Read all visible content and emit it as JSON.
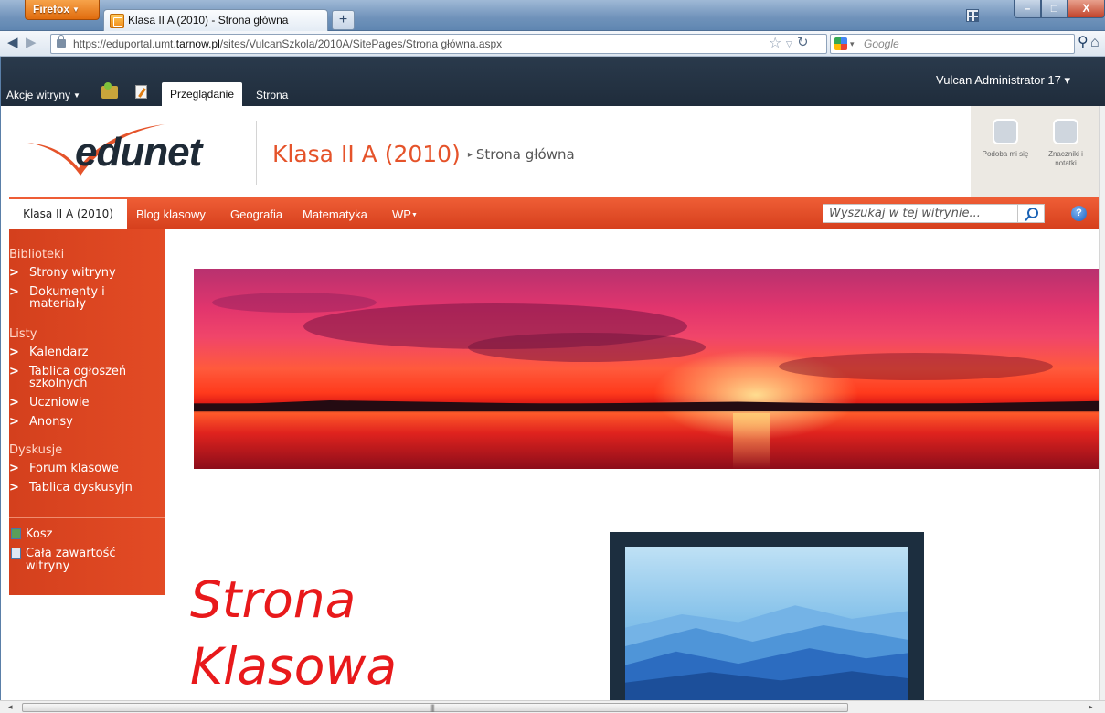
{
  "browser": {
    "app_button": "Firefox",
    "tab_title": "Klasa II A (2010) - Strona główna",
    "new_tab": "+",
    "url_prefix": "https://eduportal.umt.",
    "url_host": "tarnow.pl",
    "url_path": "/sites/VulcanSzkola/2010A/SitePages/Strona główna.aspx",
    "search_engine_placeholder": "Google",
    "window_buttons": {
      "minimize": "–",
      "maximize": "□",
      "close": "X"
    }
  },
  "ribbon": {
    "site_actions": "Akcje witryny",
    "tabs": [
      {
        "label": "Przeglądanie",
        "active": true
      },
      {
        "label": "Strona",
        "active": false
      }
    ],
    "user": "Vulcan Administrator 17"
  },
  "header": {
    "logo_text": "edunet",
    "site_title": "Klasa II A (2010)",
    "separator": "▸",
    "page_title": "Strona główna",
    "social": [
      {
        "icon": "like-tag-icon",
        "label": "Podoba mi się"
      },
      {
        "icon": "tags-notes-icon",
        "label": "Znaczniki i notatki"
      }
    ]
  },
  "topnav": {
    "home": "Klasa II A (2010)",
    "links": [
      "Blog klasowy",
      "Geografia",
      "Matematyka",
      "WP"
    ],
    "search_placeholder": "Wyszukaj w tej witrynie...",
    "help": "?"
  },
  "leftnav": {
    "sections": [
      {
        "heading": "Biblioteki",
        "items": [
          "Strony witryny",
          "Dokumenty i materiały"
        ]
      },
      {
        "heading": "Listy",
        "items": [
          "Kalendarz",
          "Tablica ogłoszeń szkolnych",
          "Uczniowie",
          "Anonsy"
        ]
      },
      {
        "heading": "Dyskusje",
        "items": [
          "Forum klasowe",
          "Tablica dyskusyjn"
        ]
      }
    ],
    "chevron": ">",
    "utilities": [
      {
        "icon": "recycle-bin-icon",
        "label": "Kosz"
      },
      {
        "icon": "all-content-icon",
        "label": "Cała zawartość witryny"
      }
    ]
  },
  "main": {
    "heading": "Strona Klasowa"
  },
  "colors": {
    "accent": "#e34b25",
    "ribbon": "#1f2c3b",
    "heading": "#e8191b"
  }
}
